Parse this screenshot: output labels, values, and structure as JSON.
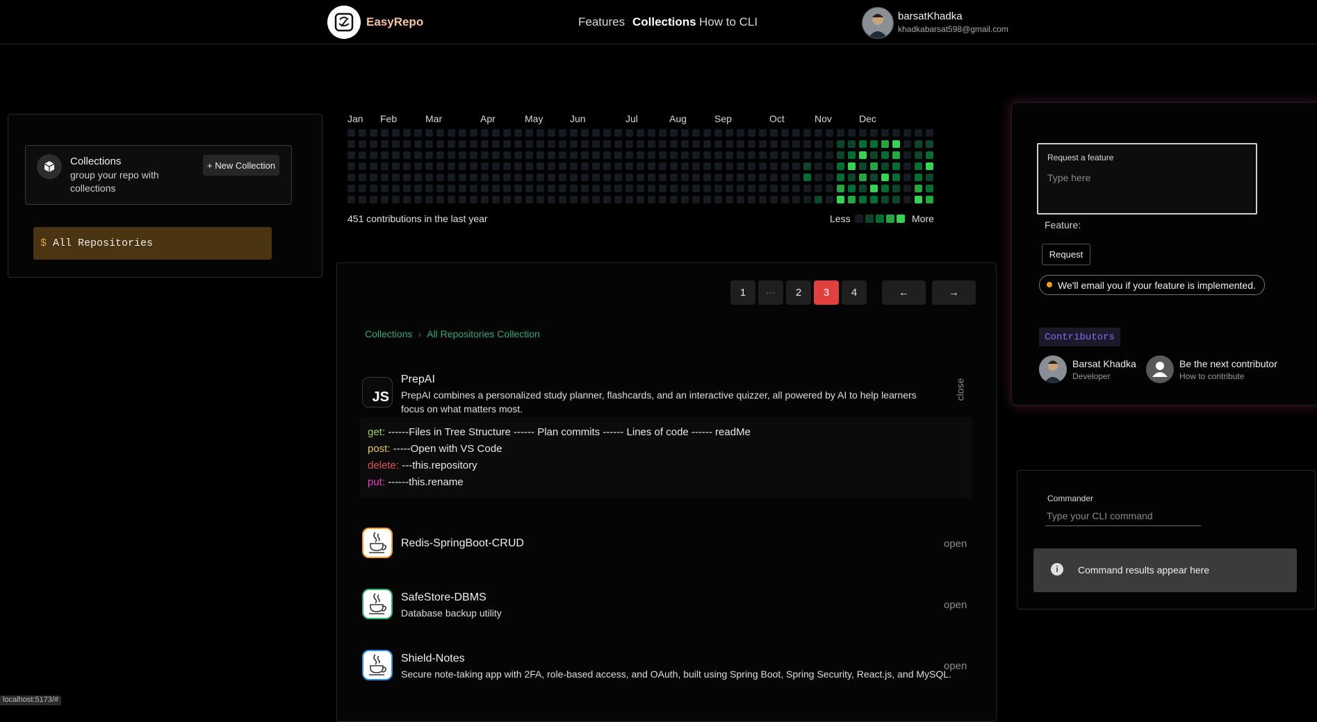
{
  "header": {
    "brand": "EasyRepo",
    "nav": [
      "Features",
      "Collections",
      "How to CLI"
    ],
    "active_nav": "Collections",
    "user": {
      "name": "barsatKhadka",
      "email": "khadkabarsat598@gmail.com"
    }
  },
  "sidebar": {
    "collections_title": "Collections",
    "collections_subtitle": "group your repo with collections",
    "new_collection_label": "+ New Collection",
    "prompt_symbol": "$",
    "all_repos_label": "All Repositories"
  },
  "contributions": {
    "months": [
      "Jan",
      "Feb",
      "Mar",
      "Apr",
      "May",
      "Jun",
      "Jul",
      "Aug",
      "Sep",
      "Oct",
      "Nov",
      "Dec"
    ],
    "summary": "451 contributions in the last year",
    "legend_less": "Less",
    "legend_more": "More",
    "colors": [
      "#161b22",
      "#0e4429",
      "#006d32",
      "#26a641",
      "#39d353"
    ]
  },
  "pagination": {
    "pages": [
      "1",
      "···",
      "2",
      "3",
      "4"
    ],
    "active": "3",
    "prev": "←",
    "next": "→"
  },
  "breadcrumb": {
    "root": "Collections",
    "current": "All Repositories Collection"
  },
  "repos": [
    {
      "name": "PrepAI",
      "description": "PrepAI combines a personalized study planner, flashcards, and an interactive quizzer, all powered by AI to help learners focus on what matters most.",
      "icon": "js-icon",
      "icon_text": "JS",
      "action": "close",
      "border_color": "#3a3a3a"
    },
    {
      "name": "Redis-SpringBoot-CRUD",
      "description": "",
      "icon": "java-icon",
      "action": "open",
      "border_color": "#f0a030"
    },
    {
      "name": "SafeStore-DBMS",
      "description": "Database backup utility",
      "icon": "java-icon",
      "action": "open",
      "border_color": "#2fb070"
    },
    {
      "name": "Shield-Notes",
      "description": "Secure note-taking app with 2FA, role-based access, and OAuth, built using Spring Boot, Spring Security, React.js, and MySQL.",
      "icon": "java-icon",
      "action": "open",
      "border_color": "#3a90e0"
    }
  ],
  "commands": [
    {
      "verb": "get:",
      "text": " ------Files in Tree Structure ------ Plan commits ------ Lines of code ------ readMe"
    },
    {
      "verb": "post:",
      "text": " -----Open with VS Code"
    },
    {
      "verb": "delete:",
      "text": " ---this.repository"
    },
    {
      "verb": "put:",
      "text": " ------this.rename"
    }
  ],
  "feature_request": {
    "label": "Request a feature",
    "placeholder": "Type here",
    "prefix": "Feature:",
    "button": "Request",
    "note": "We'll email you if your feature is implemented."
  },
  "contributors": {
    "label": "Contributors",
    "items": [
      {
        "name": "Barsat Khadka",
        "role": "Developer"
      },
      {
        "name": "Be the next contributor",
        "role": "How to contribute"
      }
    ]
  },
  "commander": {
    "label": "Commander",
    "placeholder": "Type your CLI command",
    "results": "Command results appear here"
  },
  "status_url": "localhost:5173/#"
}
